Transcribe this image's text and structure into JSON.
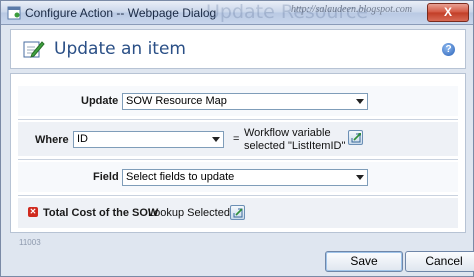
{
  "window": {
    "title": "Configure Action -- Webpage Dialog",
    "watermark": "Update Resource",
    "watermark_url": "http://salaudeen.blogspot.com",
    "close_label": "X"
  },
  "header": {
    "title": "Update an item",
    "help_label": "?"
  },
  "form": {
    "update": {
      "label": "Update",
      "value": "SOW Resource Map"
    },
    "where": {
      "label": "Where",
      "field_value": "ID",
      "equals": "=",
      "workflow_line1": "Workflow variable",
      "workflow_line2": "selected \"ListItemID\""
    },
    "field": {
      "label": "Field",
      "value": "Select fields to update"
    },
    "item": {
      "label": "Total Cost of the SOW",
      "value": "Lookup Selected"
    }
  },
  "footer": {
    "id_text": "11003",
    "save_label": "Save",
    "cancel_label": "Cancel"
  },
  "colors": {
    "title_blue": "#2a4f86",
    "error_red": "#d02a1e",
    "border_blue": "#7f9db9"
  }
}
